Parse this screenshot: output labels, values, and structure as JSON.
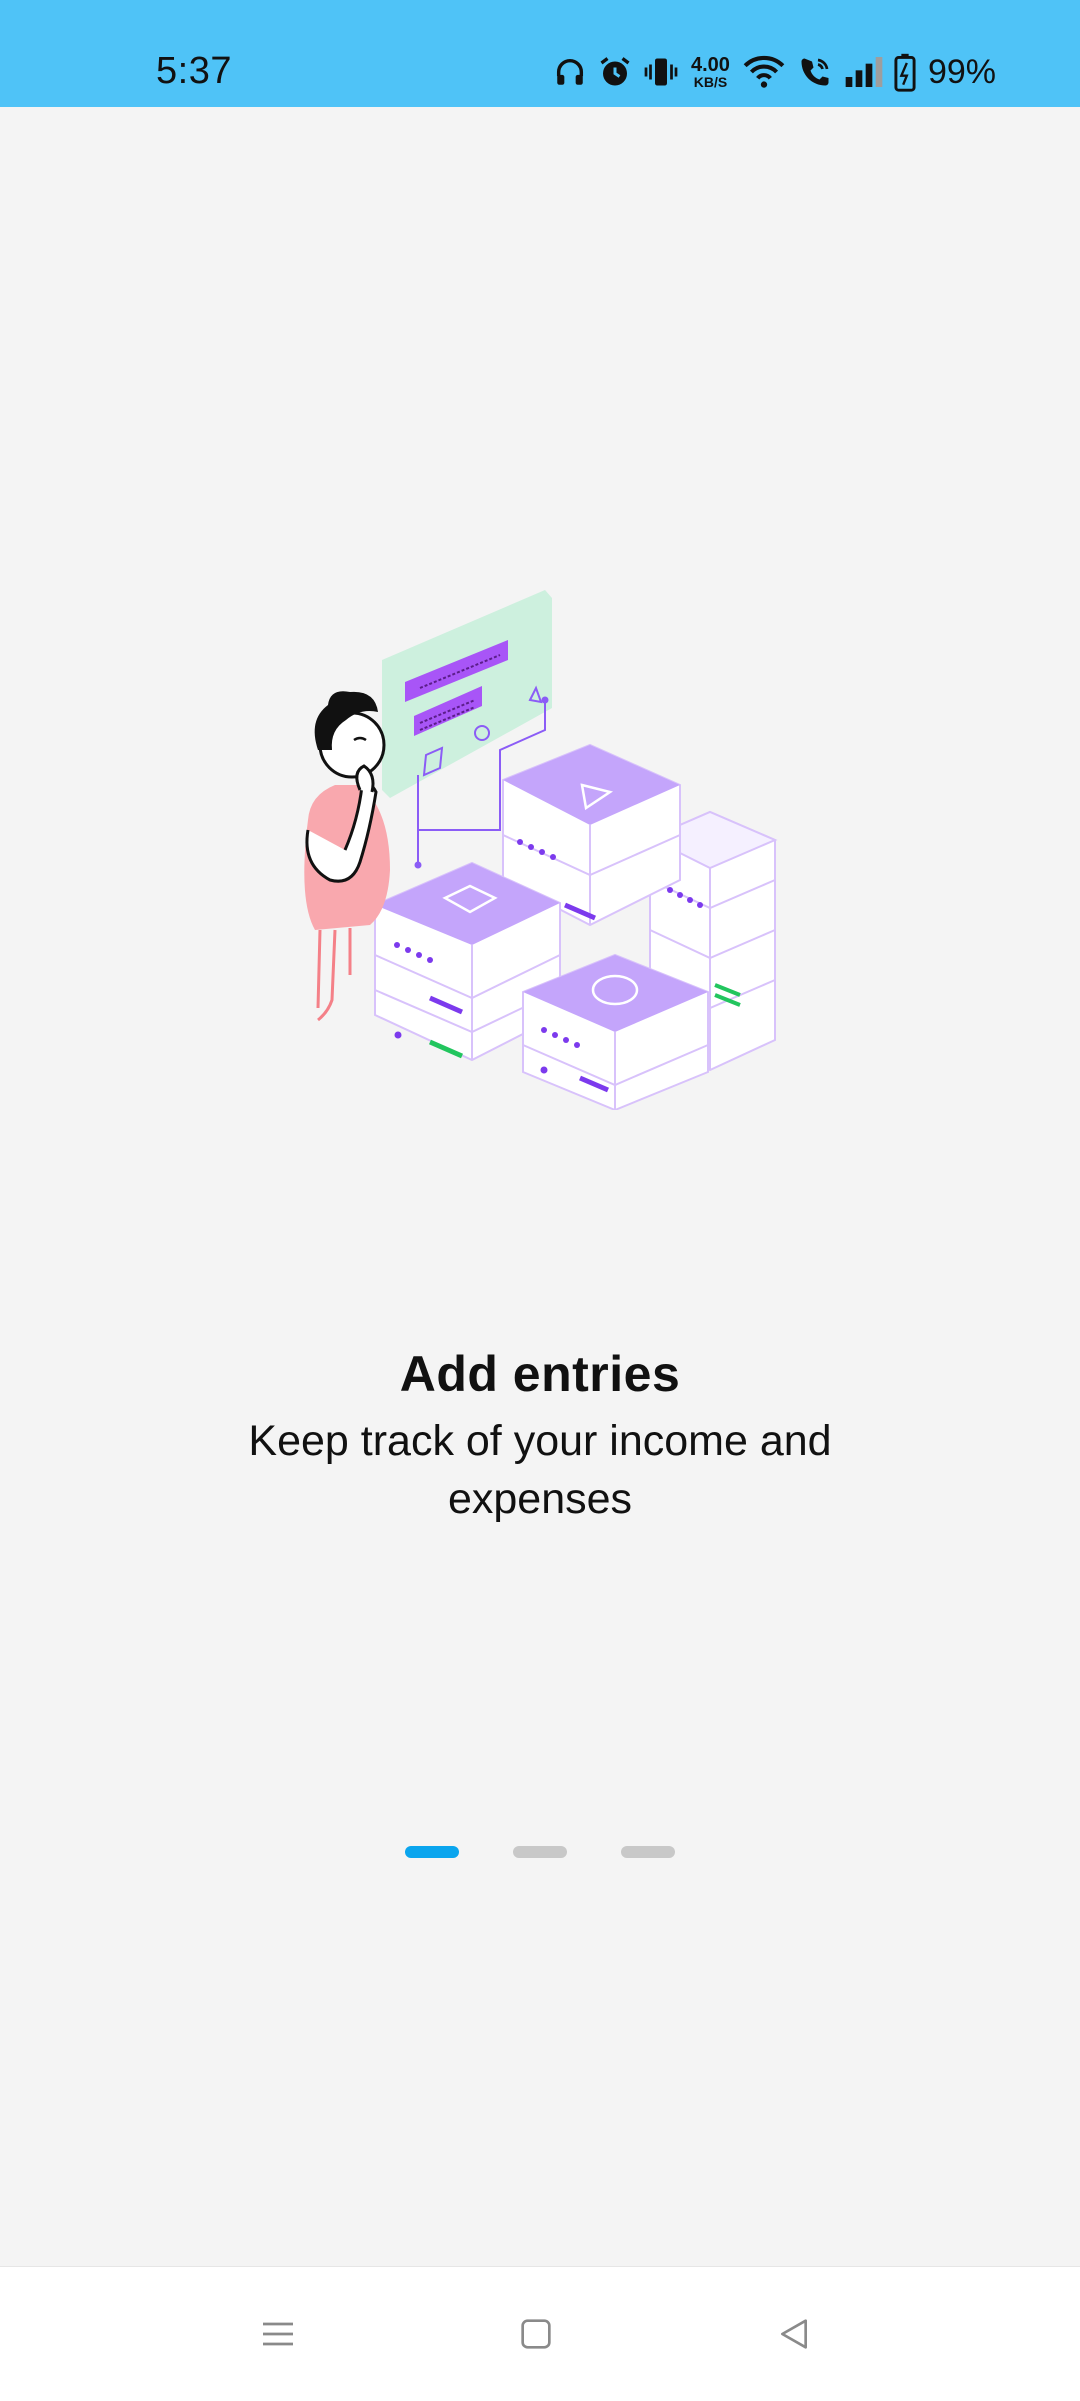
{
  "status_bar": {
    "time": "5:37",
    "net_speed_value": "4.00",
    "net_speed_unit": "KB/S",
    "battery": "99%",
    "icons": [
      "headphones-icon",
      "alarm-icon",
      "vibrate-icon",
      "wifi-icon",
      "wifi-call-icon",
      "signal-icon",
      "battery-icon"
    ],
    "color": "#4fc3f7"
  },
  "onboarding": {
    "title": "Add entries",
    "subtitle": "Keep track of your income and expenses",
    "current_page": 1,
    "total_pages": 3,
    "accent_color": "#0aa5ee"
  },
  "nav_bar": {
    "buttons": [
      "menu-icon",
      "home-icon",
      "back-icon"
    ]
  }
}
